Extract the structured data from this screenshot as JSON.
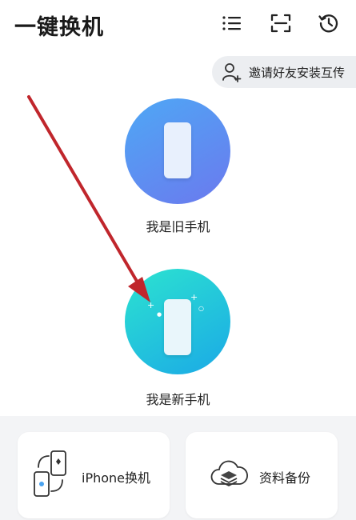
{
  "header": {
    "title": "一键换机"
  },
  "invite": {
    "label": "邀请好友安装互传"
  },
  "options": {
    "old_phone": "我是旧手机",
    "new_phone": "我是新手机"
  },
  "cards": {
    "iphone": "iPhone换机",
    "backup": "资料备份"
  },
  "colors": {
    "old_gradient_start": "#4ea8f5",
    "old_gradient_end": "#6b79ee",
    "new_gradient_start": "#2ce3d0",
    "new_gradient_end": "#1ba9e6",
    "arrow": "#c0262c"
  },
  "icons": {
    "list": "list-icon",
    "scan": "scan-icon",
    "history": "history-icon",
    "invite": "add-user-icon",
    "iphone": "phone-swap-icon",
    "backup": "cloud-backup-icon"
  }
}
